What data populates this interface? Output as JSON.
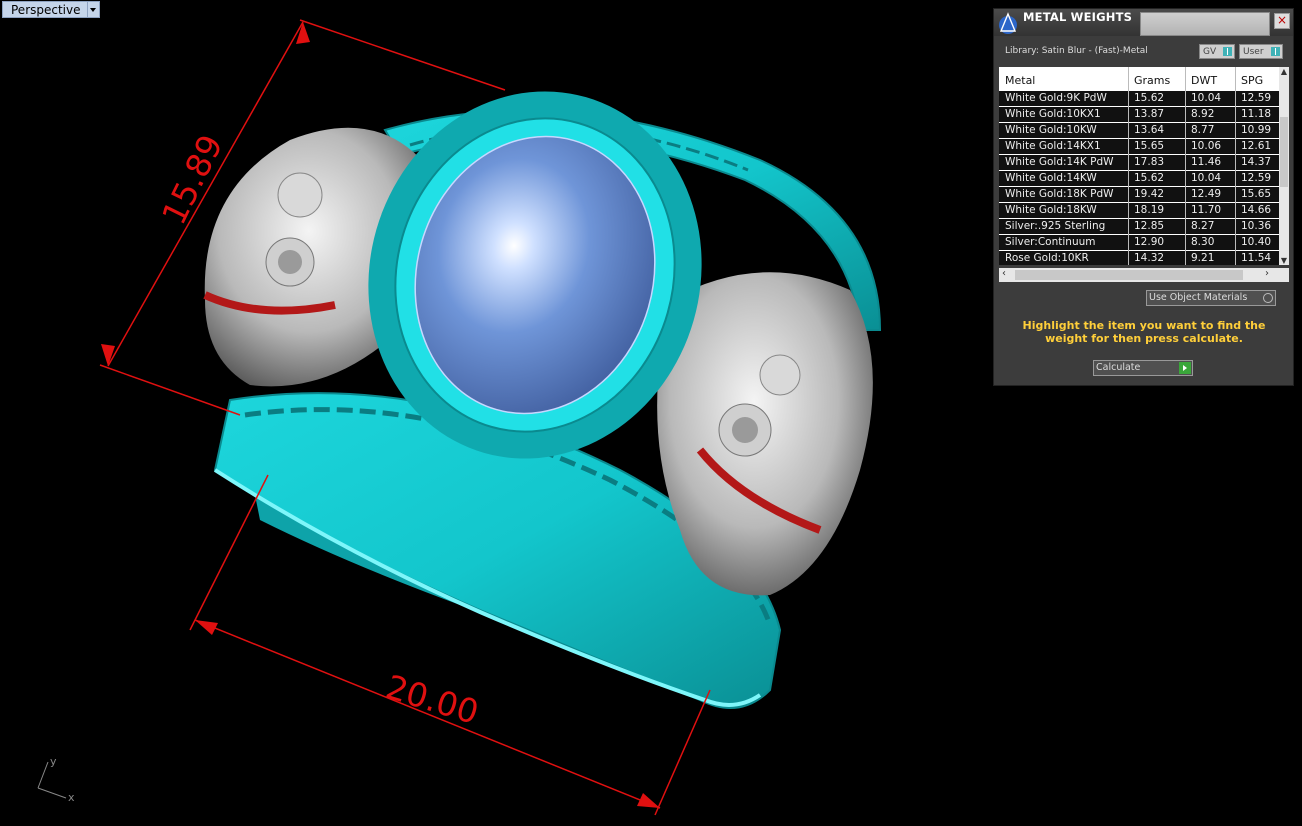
{
  "viewport": {
    "label": "Perspective",
    "dim_vertical": "15.89",
    "dim_horizontal": "20.00",
    "axis_x": "x",
    "axis_y": "y"
  },
  "panel": {
    "title": "METAL WEIGHTS",
    "library": "Library: Satin Blur - (Fast)-Metal",
    "toggle_gv": "GV",
    "toggle_user": "User",
    "columns": [
      "Metal",
      "Grams",
      "DWT",
      "SPG"
    ],
    "rows": [
      [
        "White Gold:9K PdW",
        "15.62",
        "10.04",
        "12.59"
      ],
      [
        "White Gold:10KX1",
        "13.87",
        "8.92",
        "11.18"
      ],
      [
        "White Gold:10KW",
        "13.64",
        "8.77",
        "10.99"
      ],
      [
        "White Gold:14KX1",
        "15.65",
        "10.06",
        "12.61"
      ],
      [
        "White Gold:14K PdW",
        "17.83",
        "11.46",
        "14.37"
      ],
      [
        "White Gold:14KW",
        "15.62",
        "10.04",
        "12.59"
      ],
      [
        "White Gold:18K PdW",
        "19.42",
        "12.49",
        "15.65"
      ],
      [
        "White Gold:18KW",
        "18.19",
        "11.70",
        "14.66"
      ],
      [
        "Silver:.925 Sterling",
        "12.85",
        "8.27",
        "10.36"
      ],
      [
        "Silver:Continuum",
        "12.90",
        "8.30",
        "10.40"
      ],
      [
        "Rose Gold:10KR",
        "14.32",
        "9.21",
        "11.54"
      ]
    ],
    "use_object_materials": "Use Object Materials",
    "hint": "Highlight the item you want to find the weight for then press calculate.",
    "calculate": "Calculate"
  }
}
